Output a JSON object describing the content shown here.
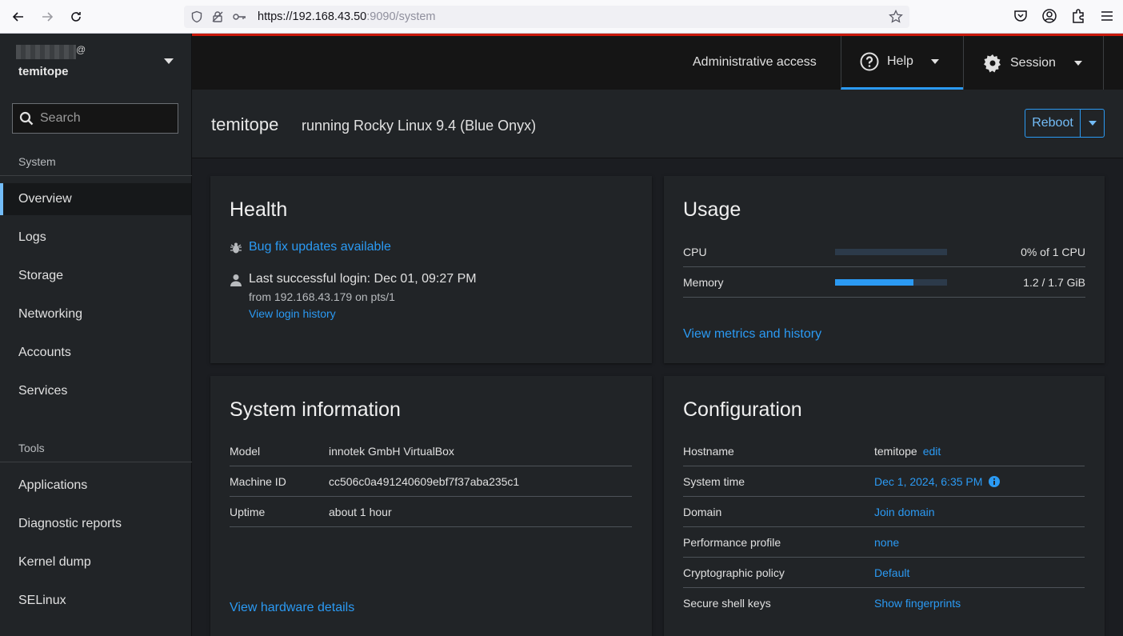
{
  "browser": {
    "url_host": "https://192.168.43.50",
    "url_rest": ":9090/system"
  },
  "sidebar": {
    "user_suffix": "@",
    "hostname": "temitope",
    "search_placeholder": "Search",
    "system_label": "System",
    "system_items": [
      {
        "label": "Overview",
        "active": true
      },
      {
        "label": "Logs"
      },
      {
        "label": "Storage"
      },
      {
        "label": "Networking"
      },
      {
        "label": "Accounts"
      },
      {
        "label": "Services"
      }
    ],
    "tools_label": "Tools",
    "tools_items": [
      {
        "label": "Applications"
      },
      {
        "label": "Diagnostic reports"
      },
      {
        "label": "Kernel dump"
      },
      {
        "label": "SELinux"
      }
    ]
  },
  "masthead": {
    "admin_access": "Administrative access",
    "help": "Help",
    "session": "Session"
  },
  "page_header": {
    "host": "temitope",
    "os": "running Rocky Linux 9.4 (Blue Onyx)",
    "reboot": "Reboot"
  },
  "health": {
    "title": "Health",
    "updates": "Bug fix updates available",
    "last_login": "Last successful login: Dec 01, 09:27 PM",
    "login_from": "from 192.168.43.179 on pts/1",
    "login_history": "View login history"
  },
  "usage": {
    "title": "Usage",
    "cpu_label": "CPU",
    "cpu_value": "0% of 1 CPU",
    "cpu_fraction": 0.0,
    "memory_label": "Memory",
    "memory_value": "1.2 / 1.7 GiB",
    "memory_fraction": 0.7,
    "metrics_link": "View metrics and history"
  },
  "sysinfo": {
    "title": "System information",
    "rows": [
      {
        "label": "Model",
        "value": "innotek GmbH VirtualBox"
      },
      {
        "label": "Machine ID",
        "value": "cc506c0a491240609ebf7f37aba235c1"
      },
      {
        "label": "Uptime",
        "value": "about 1 hour"
      }
    ],
    "hardware_link": "View hardware details"
  },
  "config": {
    "title": "Configuration",
    "hostname_label": "Hostname",
    "hostname_value": "temitope",
    "hostname_edit": "edit",
    "time_label": "System time",
    "time_value": "Dec 1, 2024, 6:35 PM",
    "domain_label": "Domain",
    "domain_value": "Join domain",
    "perf_label": "Performance profile",
    "perf_value": "none",
    "crypto_label": "Cryptographic policy",
    "crypto_value": "Default",
    "ssh_label": "Secure shell keys",
    "ssh_value": "Show fingerprints"
  },
  "colors": {
    "accent": "#2b9af3",
    "masthead_stripe": "#c9190b"
  }
}
